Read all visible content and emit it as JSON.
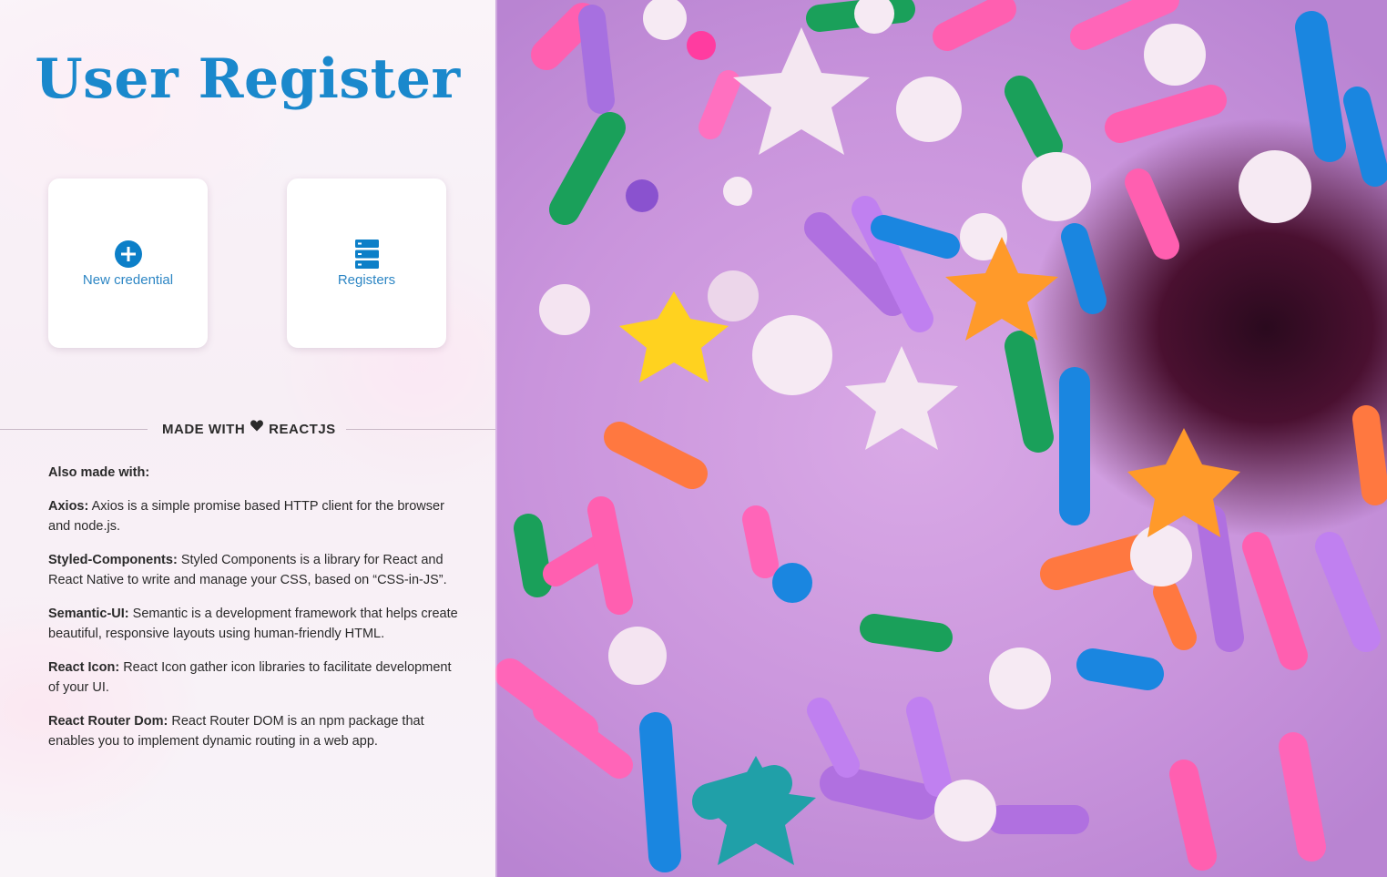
{
  "header": {
    "title": "User Register"
  },
  "cards": [
    {
      "label": "New credential",
      "icon": "plus-circle-icon"
    },
    {
      "label": "Registers",
      "icon": "server-icon"
    }
  ],
  "made_with": {
    "prefix": "MADE WITH",
    "icon": "heart-icon",
    "suffix": "REACTJS"
  },
  "also_made": {
    "heading": "Also made with:",
    "libs": [
      {
        "name": "Axios:",
        "desc": "Axios is a simple promise based HTTP client for the browser and node.js."
      },
      {
        "name": "Styled-Components:",
        "desc": "Styled Components is a library for React and React Native to write and manage your CSS, based on “CSS-in-JS”."
      },
      {
        "name": "Semantic-UI:",
        "desc": "Semantic is a development framework that helps create beautiful, responsive layouts using human-friendly HTML."
      },
      {
        "name": "React Icon:",
        "desc": "React Icon gather icon libraries to facilitate development of your UI."
      },
      {
        "name": "React Router Dom:",
        "desc": "React Router DOM is an npm package that enables you to implement dynamic routing in a web app."
      }
    ]
  },
  "colors": {
    "accent": "#1a88cc",
    "card_label": "#2d86c4",
    "icon_blue": "#0c7fc8",
    "text": "#2a2a2a"
  }
}
